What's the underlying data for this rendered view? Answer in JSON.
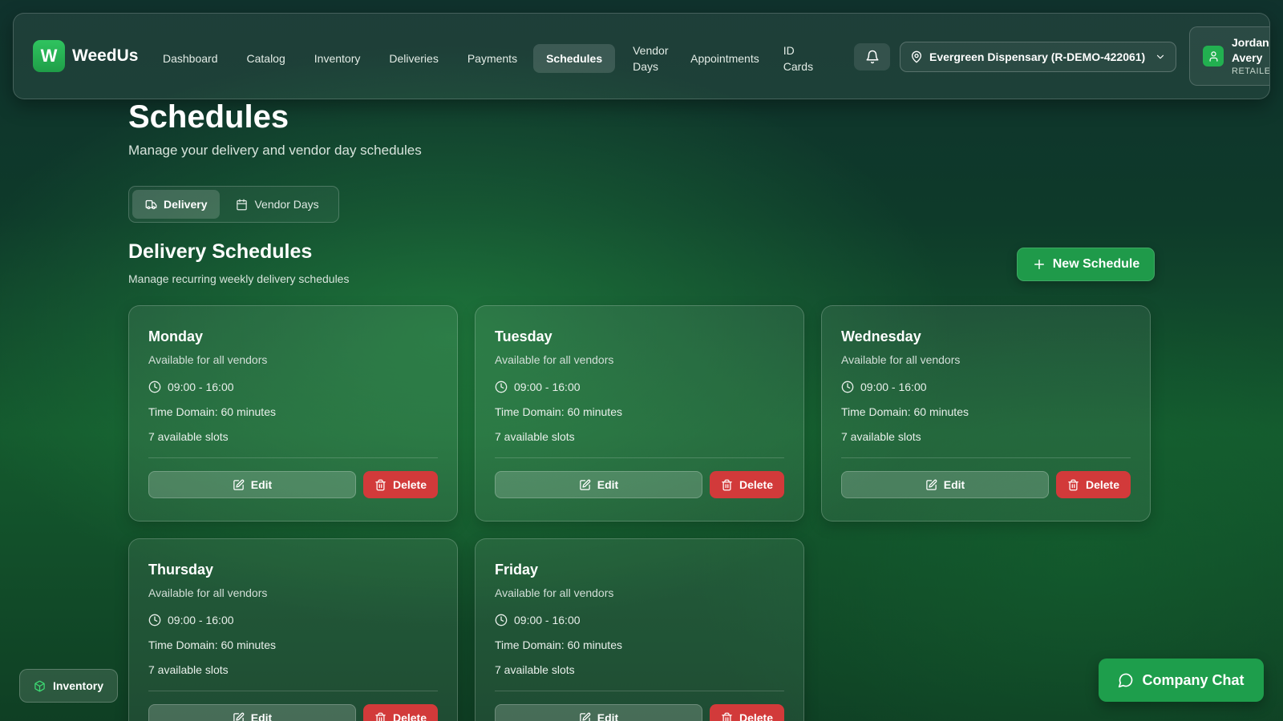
{
  "app": {
    "logo_letter": "W",
    "name": "WeedUs"
  },
  "nav": {
    "items": [
      "Dashboard",
      "Catalog",
      "Inventory",
      "Deliveries",
      "Payments",
      "Schedules",
      "Vendor Days",
      "Appointments",
      "ID Cards"
    ],
    "active": "Schedules"
  },
  "location": {
    "label": "Evergreen Dispensary (R-DEMO-422061)"
  },
  "user": {
    "name": "Jordan Avery",
    "role": "RETAILER"
  },
  "page": {
    "title": "Schedules",
    "subtitle": "Manage your delivery and vendor day schedules"
  },
  "tabs": {
    "delivery": "Delivery",
    "vendor_days": "Vendor Days",
    "active": "Delivery"
  },
  "section": {
    "title": "Delivery Schedules",
    "subtitle": "Manage recurring weekly delivery schedules",
    "new_button": "New Schedule"
  },
  "schedules": [
    {
      "day": "Monday",
      "availability": "Available for all vendors",
      "time": "09:00 - 16:00",
      "domain": "Time Domain: 60 minutes",
      "slots": "7 available slots",
      "edit": "Edit",
      "delete": "Delete"
    },
    {
      "day": "Tuesday",
      "availability": "Available for all vendors",
      "time": "09:00 - 16:00",
      "domain": "Time Domain: 60 minutes",
      "slots": "7 available slots",
      "edit": "Edit",
      "delete": "Delete"
    },
    {
      "day": "Wednesday",
      "availability": "Available for all vendors",
      "time": "09:00 - 16:00",
      "domain": "Time Domain: 60 minutes",
      "slots": "7 available slots",
      "edit": "Edit",
      "delete": "Delete"
    },
    {
      "day": "Thursday",
      "availability": "Available for all vendors",
      "time": "09:00 - 16:00",
      "domain": "Time Domain: 60 minutes",
      "slots": "7 available slots",
      "edit": "Edit",
      "delete": "Delete"
    },
    {
      "day": "Friday",
      "availability": "Available for all vendors",
      "time": "09:00 - 16:00",
      "domain": "Time Domain: 60 minutes",
      "slots": "7 available slots",
      "edit": "Edit",
      "delete": "Delete"
    }
  ],
  "floating": {
    "inventory": "Inventory",
    "chat": "Company Chat"
  },
  "colors": {
    "accent": "#1f9a4a",
    "danger": "#d23a3a",
    "logo": "#2fc35f"
  },
  "icons": [
    "bell-icon",
    "map-pin-icon",
    "chevron-down-icon",
    "user-icon",
    "truck-icon",
    "calendar-icon",
    "plus-icon",
    "clock-icon",
    "edit-icon",
    "trash-icon",
    "package-icon",
    "message-icon"
  ]
}
